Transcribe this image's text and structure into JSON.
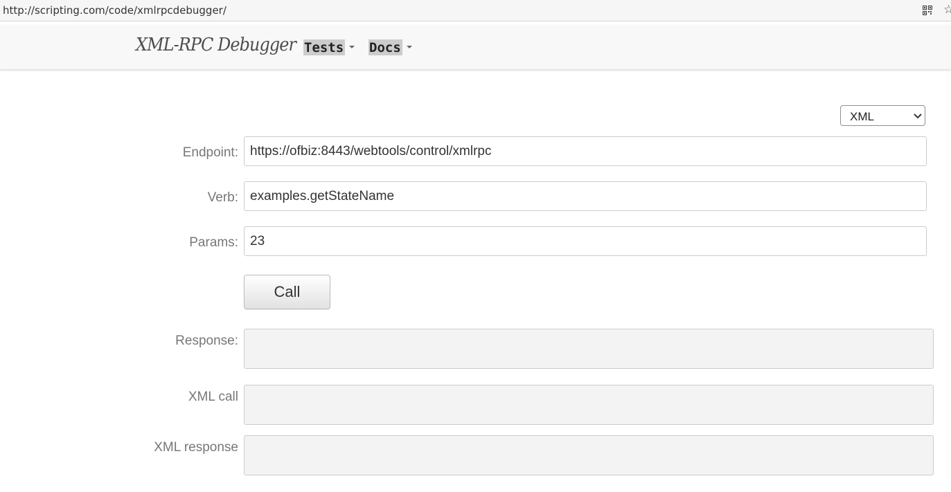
{
  "browser": {
    "url": "http://scripting.com/code/xmlrpcdebugger/"
  },
  "navbar": {
    "brand": "XML-RPC Debugger",
    "menus": [
      {
        "label": "Tests"
      },
      {
        "label": "Docs"
      }
    ]
  },
  "format_select": {
    "selected": "XML"
  },
  "form": {
    "endpoint_label": "Endpoint:",
    "endpoint_value": "https://ofbiz:8443/webtools/control/xmlrpc",
    "verb_label": "Verb:",
    "verb_value": "examples.getStateName",
    "params_label": "Params:",
    "params_value": "23",
    "call_label": "Call",
    "response_label": "Response:",
    "xml_call_label": "XML call",
    "xml_response_label": "XML response"
  }
}
